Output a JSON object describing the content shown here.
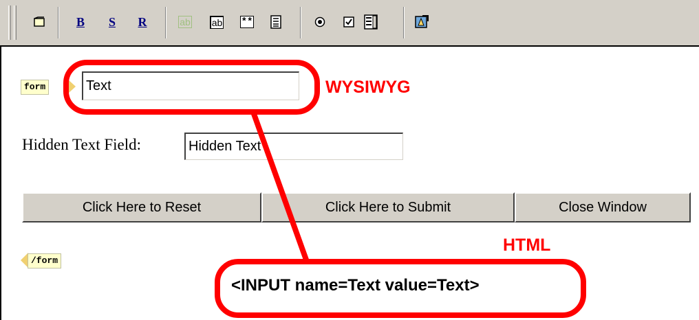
{
  "toolbar": {
    "buttons": [
      {
        "name": "form-icon"
      },
      {
        "name": "bold-button",
        "label": "B"
      },
      {
        "name": "strike-button",
        "label": "S"
      },
      {
        "name": "reset-style-button",
        "label": "R"
      },
      {
        "name": "hidden-text-field-icon",
        "label": "ab"
      },
      {
        "name": "text-field-icon",
        "label": "ab"
      },
      {
        "name": "password-field-icon",
        "label": "**"
      },
      {
        "name": "textarea-icon"
      },
      {
        "name": "radio-button-icon"
      },
      {
        "name": "checkbox-icon"
      },
      {
        "name": "select-list-icon"
      },
      {
        "name": "submit-image-icon"
      }
    ]
  },
  "editor": {
    "form_open_tag": "form",
    "form_close_tag": "/form",
    "text_field_value": "Text",
    "hidden_field_label": "Hidden Text Field:",
    "hidden_field_value": "Hidden Text",
    "buttons": {
      "reset": "Click Here to Reset",
      "submit": "Click Here to Submit",
      "close": "Close Window"
    }
  },
  "annotations": {
    "wysiwyg_label": "WYSIWYG",
    "html_label": "HTML",
    "code": "<INPUT name=Text value=Text>",
    "color": "#ff0000"
  }
}
